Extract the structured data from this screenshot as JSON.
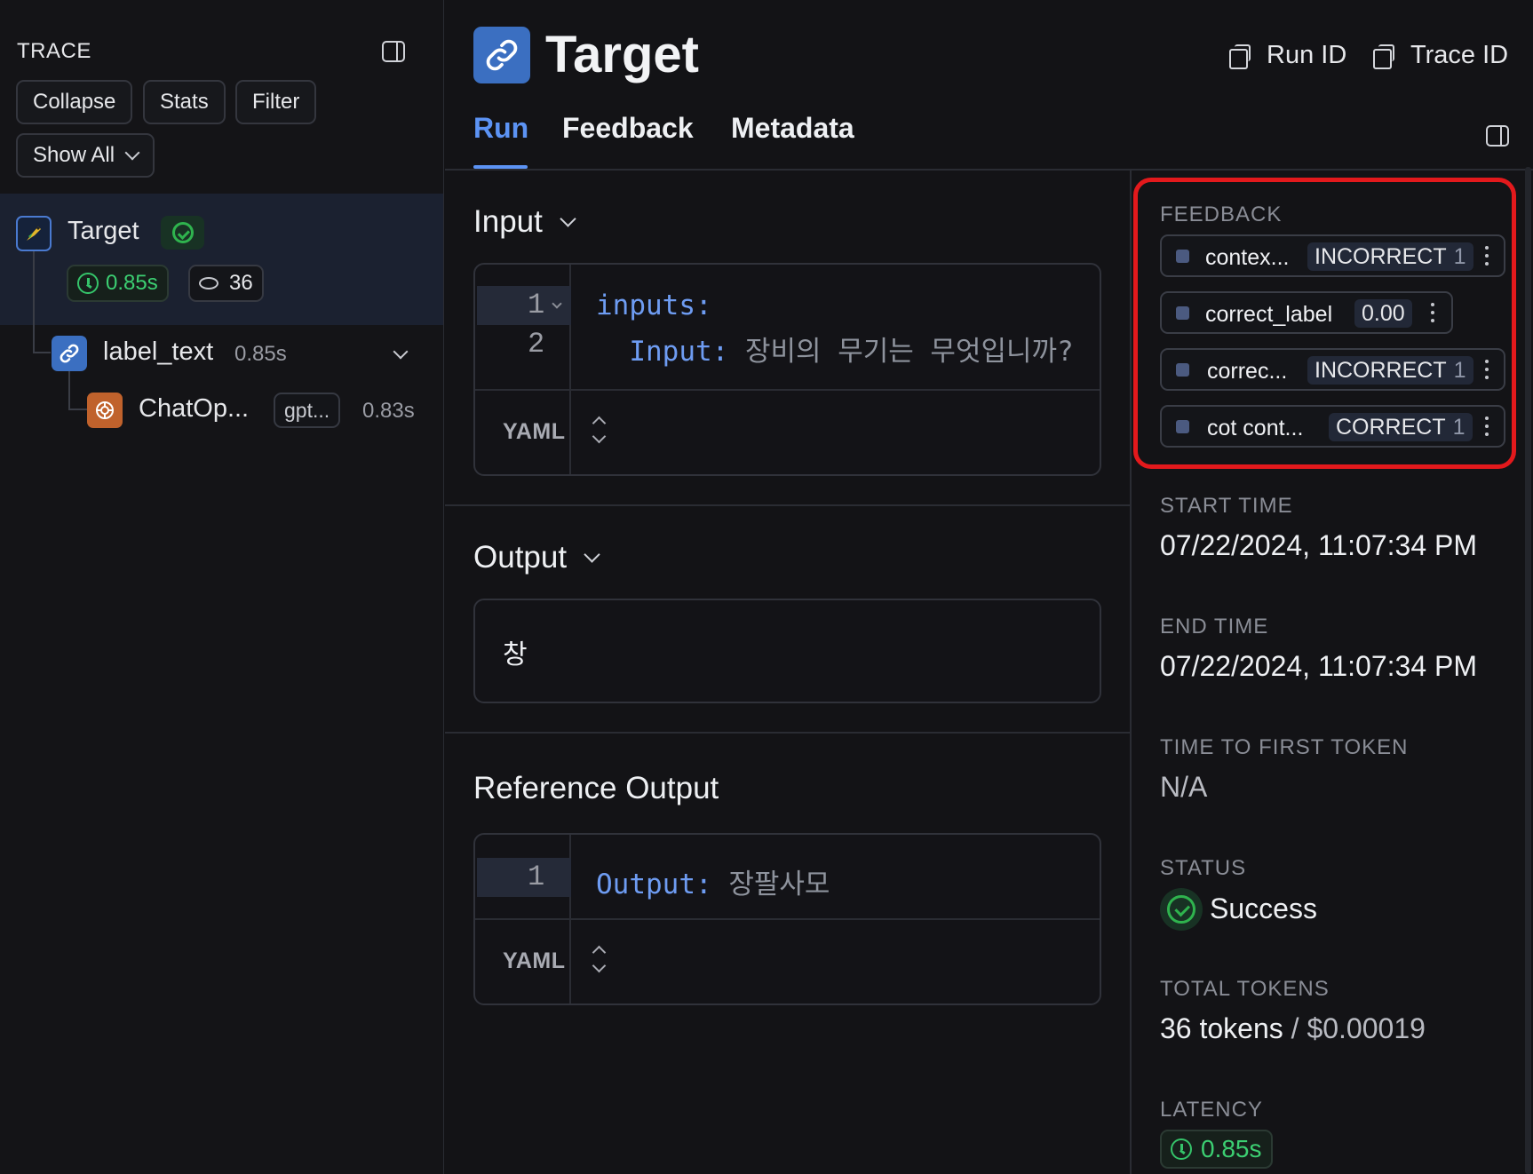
{
  "trace_panel": {
    "title": "TRACE",
    "buttons": {
      "collapse": "Collapse",
      "stats": "Stats",
      "filter": "Filter",
      "show_all": "Show All"
    },
    "nodes": [
      {
        "name": "Target",
        "status": "success",
        "latency": "0.85s",
        "tokens": "36"
      },
      {
        "name": "label_text",
        "latency": "0.85s"
      },
      {
        "name": "ChatOp...",
        "model": "gpt...",
        "latency": "0.83s"
      }
    ]
  },
  "header": {
    "title": "Target",
    "run_id_label": "Run ID",
    "trace_id_label": "Trace ID"
  },
  "tabs": [
    "Run",
    "Feedback",
    "Metadata"
  ],
  "active_tab": "Run",
  "main": {
    "input": {
      "title": "Input",
      "lines": [
        {
          "num": "1",
          "key": "inputs:",
          "value": ""
        },
        {
          "num": "2",
          "key": "  Input:",
          "value": " 장비의 무기는 무엇입니까?"
        }
      ],
      "format": "YAML"
    },
    "output": {
      "title": "Output",
      "value": "창"
    },
    "reference_output": {
      "title": "Reference Output",
      "lines": [
        {
          "num": "1",
          "key": "Output:",
          "value": " 장팔사모"
        }
      ],
      "format": "YAML"
    }
  },
  "sidebar": {
    "feedback_label": "FEEDBACK",
    "feedback": [
      {
        "name": "contex...",
        "value": "INCORRECT",
        "count": "1"
      },
      {
        "name": "correct_label",
        "value": "0.00",
        "count": ""
      },
      {
        "name": "correc...",
        "value": "INCORRECT",
        "count": "1"
      },
      {
        "name": "cot cont...",
        "value": "CORRECT",
        "count": "1"
      }
    ],
    "start_time_label": "START TIME",
    "start_time": "07/22/2024, 11:07:34 PM",
    "end_time_label": "END TIME",
    "end_time": "07/22/2024, 11:07:34 PM",
    "ttft_label": "TIME TO FIRST TOKEN",
    "ttft": "N/A",
    "status_label": "STATUS",
    "status": "Success",
    "total_tokens_label": "TOTAL TOKENS",
    "total_tokens": "36 tokens",
    "cost_sep": " / ",
    "cost": "$0.00019",
    "latency_label": "LATENCY",
    "latency": "0.85s"
  },
  "colors": {
    "accent": "#5c93f4",
    "success": "#2fb34e",
    "highlight_border": "#e3191c",
    "background": "#131316"
  }
}
